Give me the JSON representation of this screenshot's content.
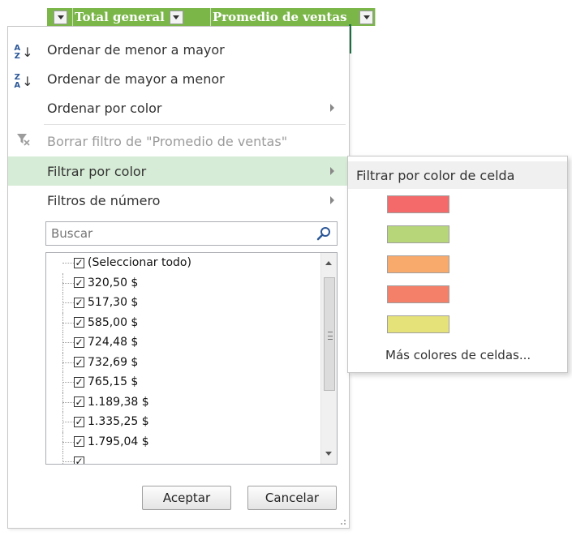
{
  "header": {
    "col2_label": "Total general",
    "col3_label": "Promedio de ventas",
    "header_color": "#7ab648"
  },
  "menu": {
    "sort_asc": {
      "label": "Ordenar de menor a mayor",
      "icon": "sort-a-to-z-icon"
    },
    "sort_desc": {
      "label": "Ordenar de mayor a menor",
      "icon": "sort-z-to-a-icon"
    },
    "sort_color": {
      "label": "Ordenar por color"
    },
    "clear_filter": {
      "label": "Borrar filtro de \"Promedio de ventas\"",
      "icon": "clear-filter-icon",
      "disabled": true
    },
    "filter_color": {
      "label": "Filtrar por color"
    },
    "number_filters": {
      "label": "Filtros de número"
    },
    "hover_color": "#d6ecd6"
  },
  "search": {
    "placeholder": "Buscar",
    "value": "Buscar",
    "icon": "search-icon"
  },
  "values": [
    {
      "label": "(Seleccionar todo)",
      "checked": true
    },
    {
      "label": "320,50 $",
      "checked": true
    },
    {
      "label": "517,30 $",
      "checked": true
    },
    {
      "label": "585,00 $",
      "checked": true
    },
    {
      "label": "724,48 $",
      "checked": true
    },
    {
      "label": "732,69 $",
      "checked": true
    },
    {
      "label": "765,15 $",
      "checked": true
    },
    {
      "label": "1.189,38 $",
      "checked": true
    },
    {
      "label": "1.335,25 $",
      "checked": true
    },
    {
      "label": "1.795,04 $",
      "checked": true
    },
    {
      "label": "",
      "checked": true
    }
  ],
  "buttons": {
    "ok": "Aceptar",
    "cancel": "Cancelar"
  },
  "submenu": {
    "title": "Filtrar por color de celda",
    "swatches": [
      "#f46a6a",
      "#b7d67a",
      "#f8a96c",
      "#f4806a",
      "#e6e27a"
    ],
    "more": "Más colores de celdas..."
  }
}
